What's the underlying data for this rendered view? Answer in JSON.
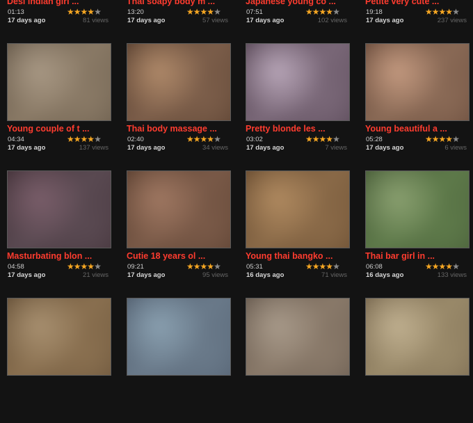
{
  "cards": [
    {
      "title": "Desi indian girl ...",
      "duration": "01:13",
      "age": "17 days ago",
      "views": "81 views",
      "rating": 4,
      "colors": [
        "#6b5a4a",
        "#8c7a68",
        "#4a3c30"
      ]
    },
    {
      "title": "Thai soapy body m ...",
      "duration": "13:20",
      "age": "17 days ago",
      "views": "57 views",
      "rating": 4,
      "colors": [
        "#7a6050",
        "#9a7c66",
        "#4c3a2e"
      ]
    },
    {
      "title": "Japanese young co ...",
      "duration": "07:51",
      "age": "17 days ago",
      "views": "102 views",
      "rating": 4,
      "colors": [
        "#6c6070",
        "#8a7a80",
        "#3e3440"
      ]
    },
    {
      "title": "Petite very cute ...",
      "duration": "19:18",
      "age": "17 days ago",
      "views": "237 views",
      "rating": 4,
      "colors": [
        "#7a6656",
        "#a08870",
        "#4a3a2e"
      ]
    },
    {
      "title": "Young couple of t ...",
      "duration": "04:34",
      "age": "17 days ago",
      "views": "137 views",
      "rating": 4,
      "colors": [
        "#8a7a66",
        "#a89884",
        "#5a4e40"
      ]
    },
    {
      "title": "Thai body massage ...",
      "duration": "02:40",
      "age": "17 days ago",
      "views": "34 views",
      "rating": 4,
      "colors": [
        "#7c5e4a",
        "#b08a6a",
        "#4a3426"
      ]
    },
    {
      "title": "Pretty blonde les ...",
      "duration": "03:02",
      "age": "17 days ago",
      "views": "7 views",
      "rating": 4,
      "colors": [
        "#7a6878",
        "#b8a6b8",
        "#4a3a48"
      ]
    },
    {
      "title": "Young beautiful a ...",
      "duration": "05:28",
      "age": "17 days ago",
      "views": "6 views",
      "rating": 4,
      "colors": [
        "#8a6a56",
        "#c49a80",
        "#5a3e30"
      ]
    },
    {
      "title": "Masturbating blon ...",
      "duration": "04:58",
      "age": "17 days ago",
      "views": "21 views",
      "rating": 4,
      "colors": [
        "#5a4a52",
        "#7a5e6a",
        "#3a2a30"
      ]
    },
    {
      "title": "Cutie 18 years ol ...",
      "duration": "09:21",
      "age": "17 days ago",
      "views": "95 views",
      "rating": 4,
      "colors": [
        "#7a5a48",
        "#a07862",
        "#4e3628"
      ]
    },
    {
      "title": "Young thai bangko ...",
      "duration": "05:31",
      "age": "16 days ago",
      "views": "71 views",
      "rating": 4,
      "colors": [
        "#8a6a48",
        "#b08a60",
        "#5a4028"
      ]
    },
    {
      "title": "Thai bar girl in ...",
      "duration": "06:08",
      "age": "16 days ago",
      "views": "133 views",
      "rating": 4,
      "colors": [
        "#5e7a4a",
        "#8aa070",
        "#3e5030"
      ]
    },
    {
      "title": "",
      "duration": "",
      "age": "",
      "views": "",
      "rating": 0,
      "colors": [
        "#8a7050",
        "#a89070",
        "#5a4630"
      ]
    },
    {
      "title": "",
      "duration": "",
      "age": "",
      "views": "",
      "rating": 0,
      "colors": [
        "#6a7a8a",
        "#8aa0b0",
        "#4a5666"
      ]
    },
    {
      "title": "",
      "duration": "",
      "age": "",
      "views": "",
      "rating": 0,
      "colors": [
        "#8a7a6a",
        "#a89a8a",
        "#5a4e44"
      ]
    },
    {
      "title": "",
      "duration": "",
      "age": "",
      "views": "",
      "rating": 0,
      "colors": [
        "#9a8a6a",
        "#c0b090",
        "#6a5a44"
      ]
    }
  ]
}
